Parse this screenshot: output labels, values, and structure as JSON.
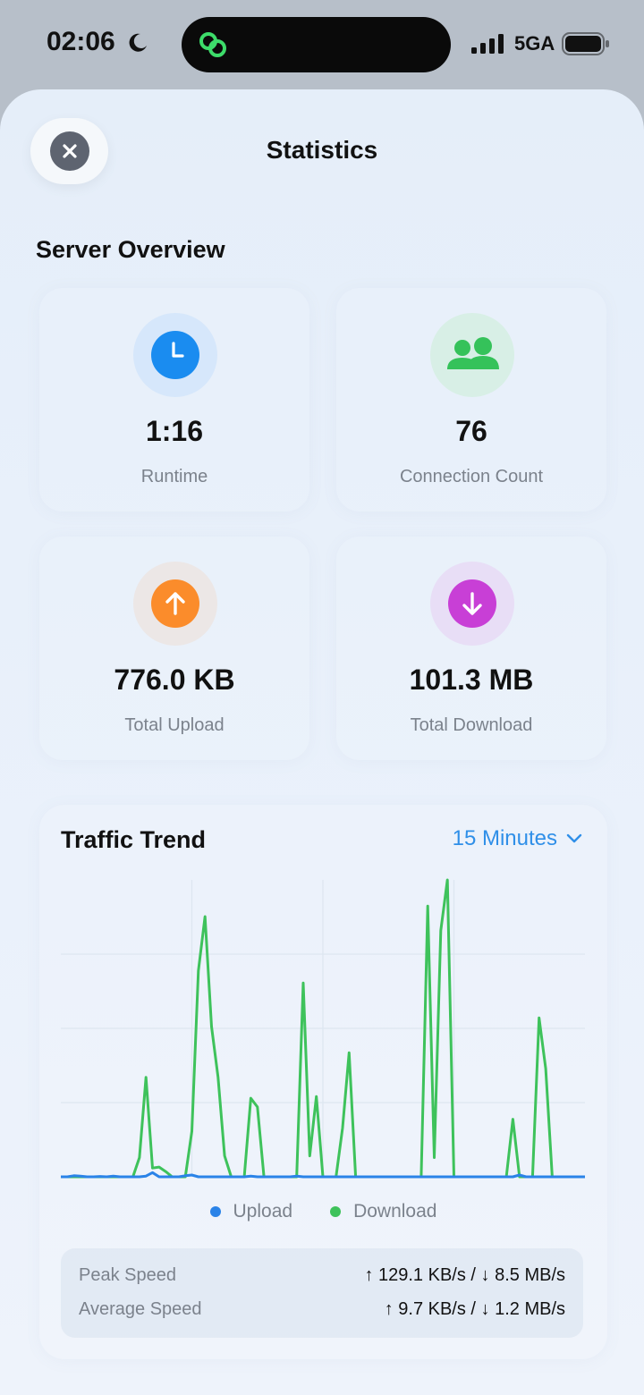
{
  "status_bar": {
    "time": "02:06",
    "network": "5GA"
  },
  "sheet": {
    "title": "Statistics"
  },
  "overview": {
    "title": "Server Overview",
    "cards": [
      {
        "value": "1:16",
        "label": "Runtime",
        "icon": "clock-icon",
        "color": "#1a8cf0",
        "ring": "#d6e7fb"
      },
      {
        "value": "76",
        "label": "Connection Count",
        "icon": "people-icon",
        "color": "#35c25a",
        "ring": "#d8efe6"
      },
      {
        "value": "776.0 KB",
        "label": "Total Upload",
        "icon": "arrow-up-icon",
        "color": "#fb8c2b",
        "ring": "#ece7e6"
      },
      {
        "value": "101.3 MB",
        "label": "Total Download",
        "icon": "arrow-down-icon",
        "color": "#c83fd6",
        "ring": "#e8def6"
      }
    ]
  },
  "traffic": {
    "title": "Traffic Trend",
    "range_label": "15 Minutes",
    "legend": {
      "upload": "Upload",
      "download": "Download"
    },
    "peak_label": "Peak Speed",
    "peak_value": "↑ 129.1 KB/s / ↓ 8.5 MB/s",
    "avg_label": "Average Speed",
    "avg_value": "↑ 9.7 KB/s / ↓ 1.2 MB/s"
  },
  "chart_data": {
    "type": "line",
    "xlabel": "",
    "ylabel": "",
    "ylim": [
      0,
      8.5
    ],
    "grid": true,
    "legend_placement": "bottom-center",
    "colors": {
      "upload": "#2a83e8",
      "download": "#3ec25b"
    },
    "x": [
      0,
      1,
      2,
      3,
      4,
      5,
      6,
      7,
      8,
      9,
      10,
      11,
      12,
      13,
      14,
      15,
      16,
      17,
      18,
      19,
      20,
      21,
      22,
      23,
      24,
      25,
      26,
      27,
      28,
      29,
      30,
      31,
      32,
      33,
      34,
      35,
      36,
      37,
      38,
      39,
      40,
      41,
      42,
      43,
      44,
      45,
      46,
      47,
      48,
      49,
      50,
      51,
      52,
      53,
      54,
      55,
      56,
      57,
      58,
      59,
      60,
      61,
      62,
      63,
      64,
      65,
      66,
      67,
      68,
      69,
      70,
      71,
      72,
      73,
      74,
      75,
      76,
      77,
      78,
      79,
      80
    ],
    "series": [
      {
        "name": "Upload",
        "values": [
          0,
          0,
          0.03,
          0.02,
          0,
          0,
          0.01,
          0,
          0.02,
          0,
          0,
          0,
          0,
          0.02,
          0.12,
          0,
          0,
          0,
          0,
          0.03,
          0.05,
          0,
          0,
          0,
          0,
          0,
          0,
          0,
          0,
          0.02,
          0,
          0,
          0,
          0,
          0,
          0,
          0.02,
          0,
          0,
          0,
          0,
          0,
          0,
          0,
          0,
          0,
          0,
          0,
          0,
          0,
          0,
          0,
          0,
          0,
          0,
          0,
          0,
          0,
          0,
          0,
          0,
          0,
          0,
          0,
          0,
          0,
          0,
          0,
          0,
          0,
          0.05,
          0,
          0,
          0,
          0,
          0,
          0,
          0,
          0,
          0,
          0
        ]
      },
      {
        "name": "Download",
        "values": [
          0,
          0,
          0,
          0,
          0,
          0,
          0,
          0,
          0,
          0,
          0,
          0,
          0.55,
          2.85,
          0.25,
          0.28,
          0.15,
          0,
          0,
          0,
          1.3,
          5.9,
          7.45,
          4.3,
          2.85,
          0.6,
          0,
          0,
          0,
          2.25,
          2.0,
          0,
          0,
          0,
          0,
          0,
          0,
          5.55,
          0.6,
          2.3,
          0,
          0,
          0,
          1.4,
          3.55,
          0,
          0,
          0,
          0,
          0,
          0,
          0,
          0,
          0,
          0,
          0,
          7.75,
          0.55,
          7.05,
          8.5,
          0,
          0,
          0,
          0,
          0,
          0,
          0,
          0,
          0,
          1.65,
          0,
          0,
          0,
          4.55,
          3.1,
          0,
          0,
          0,
          0,
          0,
          0
        ]
      }
    ]
  }
}
